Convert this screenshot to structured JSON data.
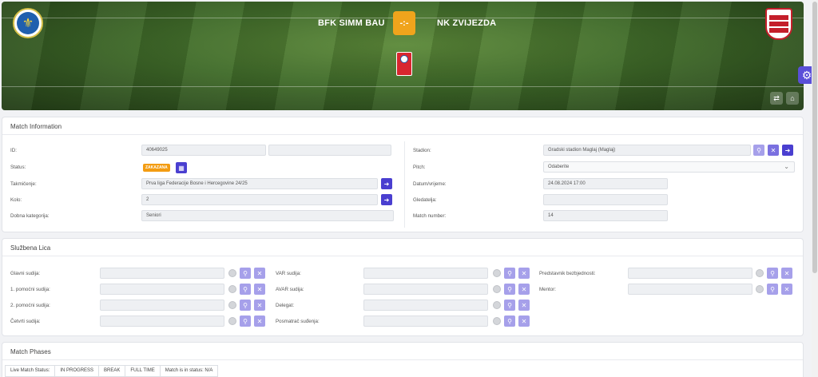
{
  "banner": {
    "home_team": "BFK SIMM BAU",
    "away_team": "NK ZVIJEZDA",
    "score": "-:-"
  },
  "match_info": {
    "title": "Match Information",
    "labels": {
      "id": "ID:",
      "status": "Status:",
      "competition": "Takmičenje:",
      "round": "Kolo:",
      "age_category": "Dobna kategorija:",
      "stadium": "Stadion:",
      "pitch": "Pitch:",
      "datetime": "Datum/vrijeme:",
      "spectators": "Gledatelja:",
      "match_number": "Match number:"
    },
    "values": {
      "id": "40649025",
      "status_badge": "ZAKAZANA",
      "competition": "Prva liga Federacije Bosne i Hercegovine 24/25",
      "round": "2",
      "age_category": "Seniori",
      "stadium": "Gradski stadion Maglaj (Maglaj)",
      "pitch": "Odaberite",
      "datetime": "24.08.2024 17:00",
      "spectators": "",
      "match_number": "14"
    }
  },
  "officials": {
    "title": "Službena Lica",
    "col1": [
      "Glavni sudija:",
      "1. pomoćni sudija:",
      "2. pomoćni sudija:",
      "Četvrti sudija:"
    ],
    "col2": [
      "VAR sudija:",
      "AVAR sudija:",
      "Delegat:",
      "Posmatrač suđenja:"
    ],
    "col3": [
      "Predstavnik bezbjednosti:",
      "Mentor:"
    ]
  },
  "phases": {
    "title": "Match Phases",
    "tabs": [
      "Live Match Status:",
      "IN PROGRESS",
      "BREAK",
      "FULL TIME",
      "Match is in status: N/A"
    ]
  },
  "icons": {
    "search": "search-icon",
    "clear": "close-icon",
    "go": "arrow-right-icon",
    "calendar": "calendar-icon",
    "settings": "gear-icon"
  },
  "colors": {
    "accent": "#4a3fd0",
    "accent_light": "#a6a0ea",
    "score": "#f0a41c",
    "status_badge": "#f39c12"
  }
}
